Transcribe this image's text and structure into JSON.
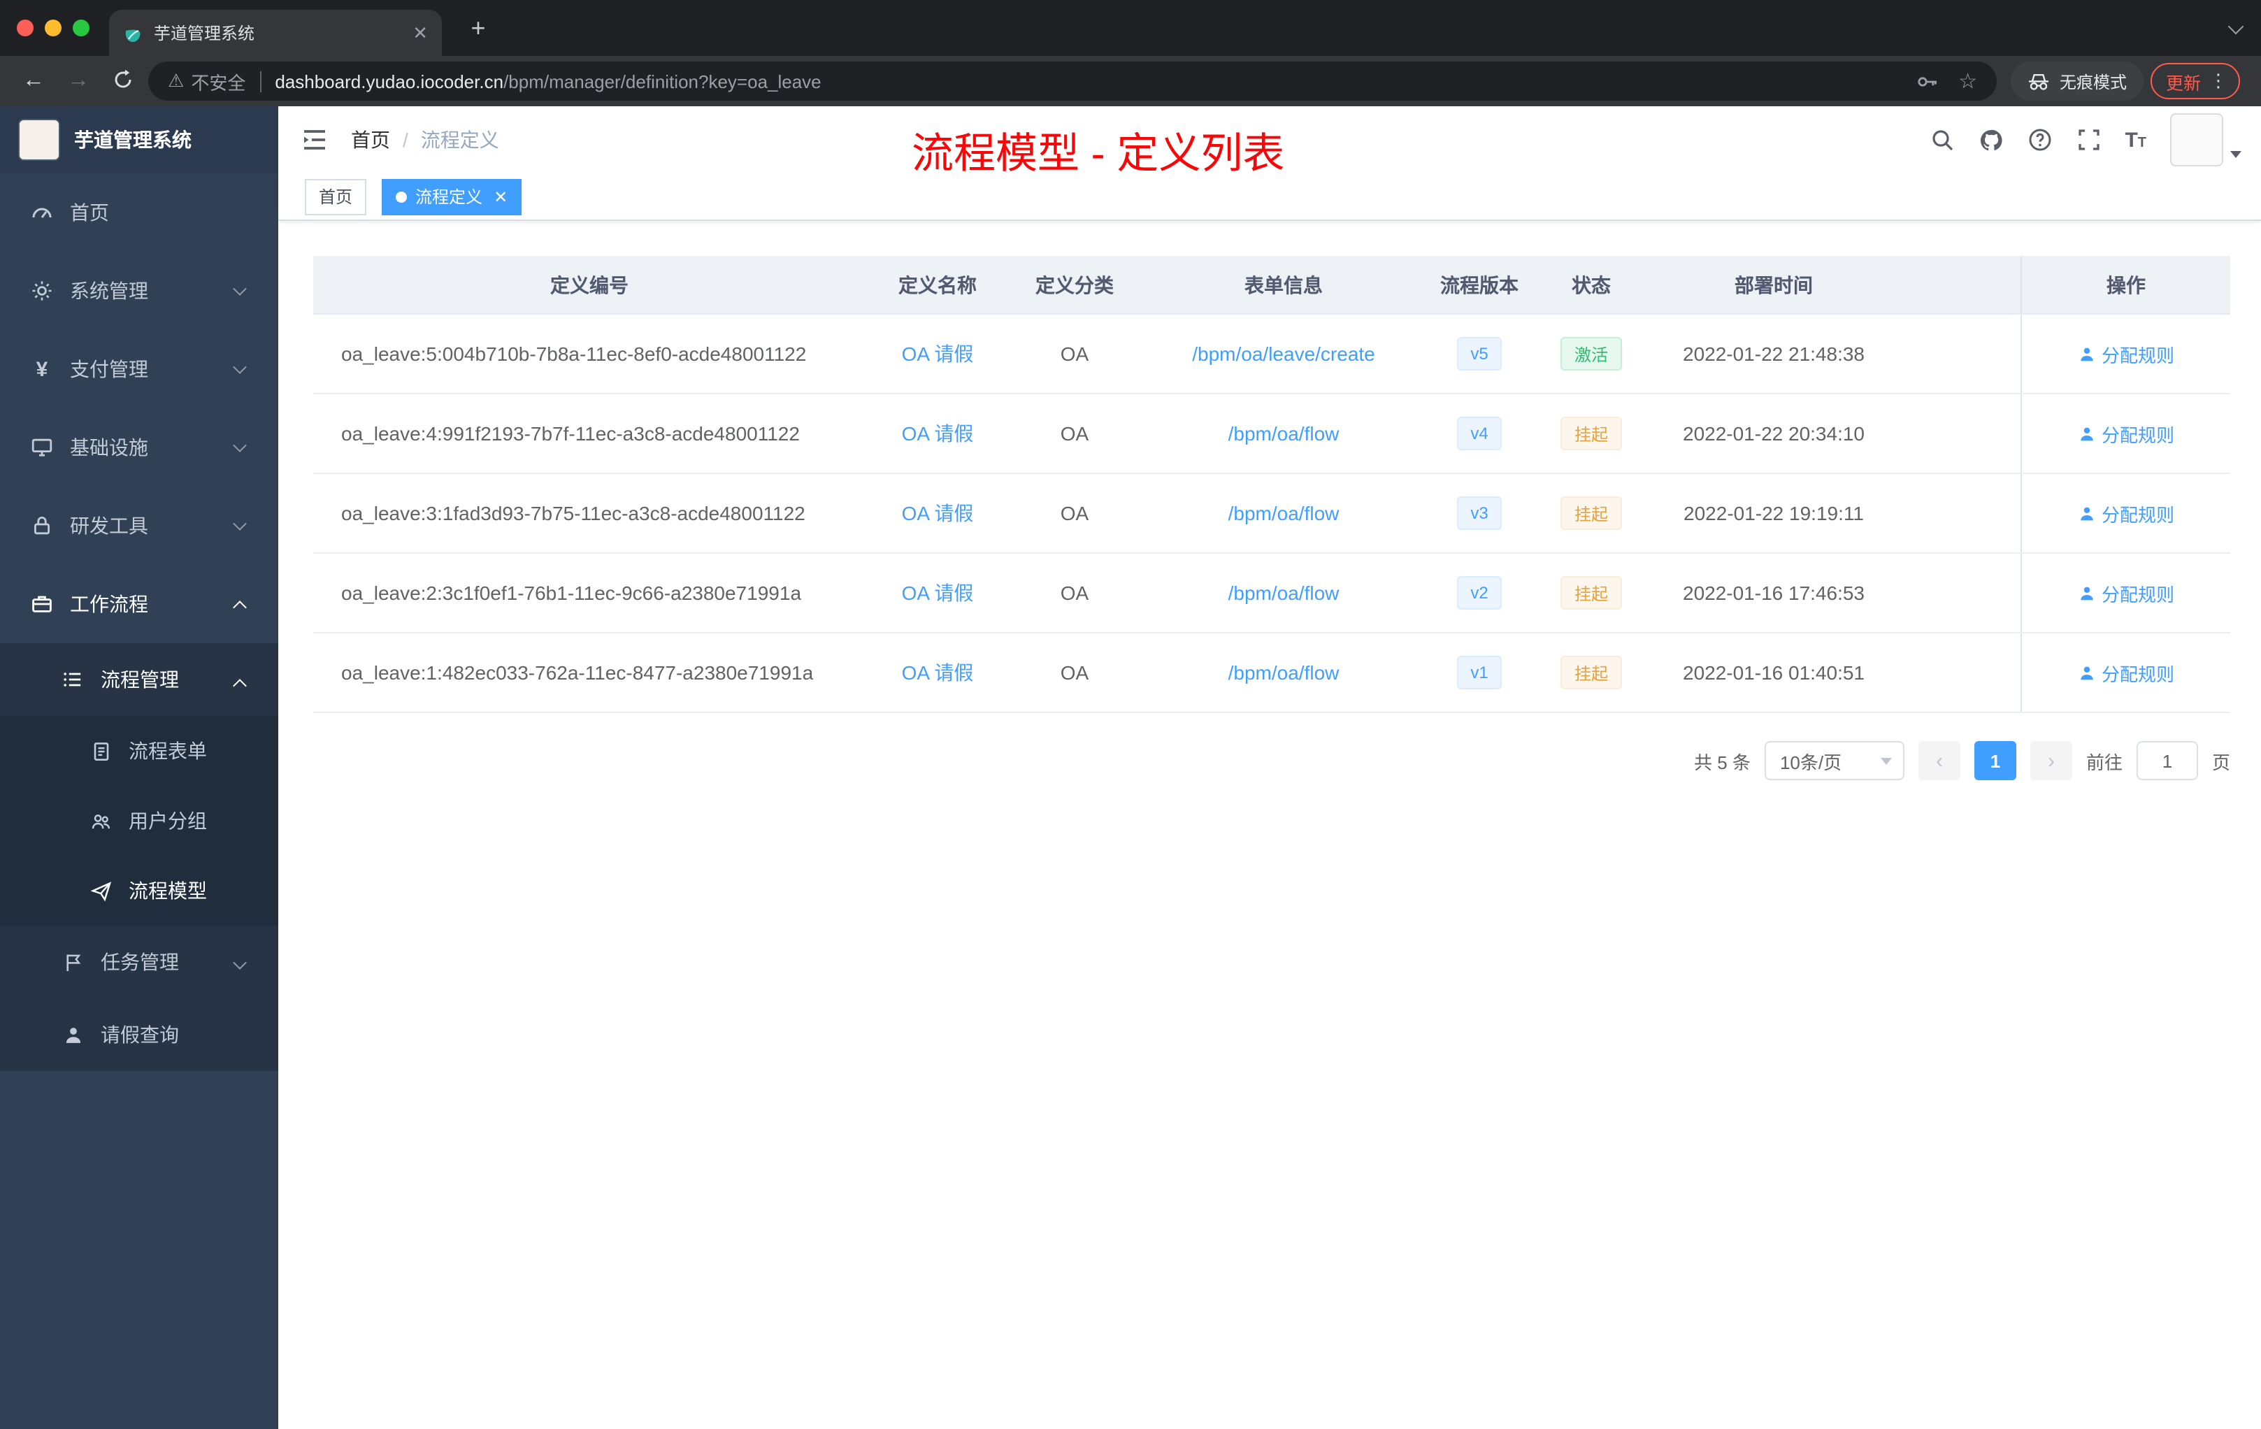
{
  "colors": {
    "accent": "#409eff",
    "success": "#2dbd6e",
    "warning": "#e6a23c",
    "annotation_red": "#f70808",
    "sidebar_bg": "#304156"
  },
  "browser": {
    "tab_title": "芋道管理系统",
    "security_label": "不安全",
    "url_host": "dashboard.yudao.iocoder.cn",
    "url_path": "/bpm/manager/definition?key=oa_leave",
    "incognito_label": "无痕模式",
    "update_label": "更新"
  },
  "sidebar": {
    "app_title": "芋道管理系统",
    "items": [
      {
        "label": "首页"
      },
      {
        "label": "系统管理"
      },
      {
        "label": "支付管理"
      },
      {
        "label": "基础设施"
      },
      {
        "label": "研发工具"
      },
      {
        "label": "工作流程"
      }
    ],
    "submenu": {
      "label": "流程管理",
      "children": [
        {
          "label": "流程表单"
        },
        {
          "label": "用户分组"
        },
        {
          "label": "流程模型"
        }
      ]
    },
    "task": {
      "label": "任务管理"
    },
    "leave": {
      "label": "请假查询"
    }
  },
  "header": {
    "breadcrumb_home": "首页",
    "breadcrumb_sep": "/",
    "breadcrumb_current": "流程定义",
    "annotation": "流程模型 - 定义列表"
  },
  "tags": {
    "home": "首页",
    "active": "流程定义"
  },
  "table": {
    "columns": [
      "定义编号",
      "定义名称",
      "定义分类",
      "表单信息",
      "流程版本",
      "状态",
      "部署时间",
      "操作"
    ],
    "rows": [
      {
        "id": "oa_leave:5:004b710b-7b8a-11ec-8ef0-acde48001122",
        "name": "OA 请假",
        "category": "OA",
        "form": "/bpm/oa/leave/create",
        "version": "v5",
        "status": "激活",
        "time": "2022-01-22 21:48:38",
        "action": "分配规则"
      },
      {
        "id": "oa_leave:4:991f2193-7b7f-11ec-a3c8-acde48001122",
        "name": "OA 请假",
        "category": "OA",
        "form": "/bpm/oa/flow",
        "version": "v4",
        "status": "挂起",
        "time": "2022-01-22 20:34:10",
        "action": "分配规则"
      },
      {
        "id": "oa_leave:3:1fad3d93-7b75-11ec-a3c8-acde48001122",
        "name": "OA 请假",
        "category": "OA",
        "form": "/bpm/oa/flow",
        "version": "v3",
        "status": "挂起",
        "time": "2022-01-22 19:19:11",
        "action": "分配规则"
      },
      {
        "id": "oa_leave:2:3c1f0ef1-76b1-11ec-9c66-a2380e71991a",
        "name": "OA 请假",
        "category": "OA",
        "form": "/bpm/oa/flow",
        "version": "v2",
        "status": "挂起",
        "time": "2022-01-16 17:46:53",
        "action": "分配规则"
      },
      {
        "id": "oa_leave:1:482ec033-762a-11ec-8477-a2380e71991a",
        "name": "OA 请假",
        "category": "OA",
        "form": "/bpm/oa/flow",
        "version": "v1",
        "status": "挂起",
        "time": "2022-01-16 01:40:51",
        "action": "分配规则"
      }
    ]
  },
  "pagination": {
    "total": "共 5 条",
    "page_size": "10条/页",
    "page": "1",
    "goto_label": "前往",
    "goto_value": "1",
    "unit": "页"
  }
}
